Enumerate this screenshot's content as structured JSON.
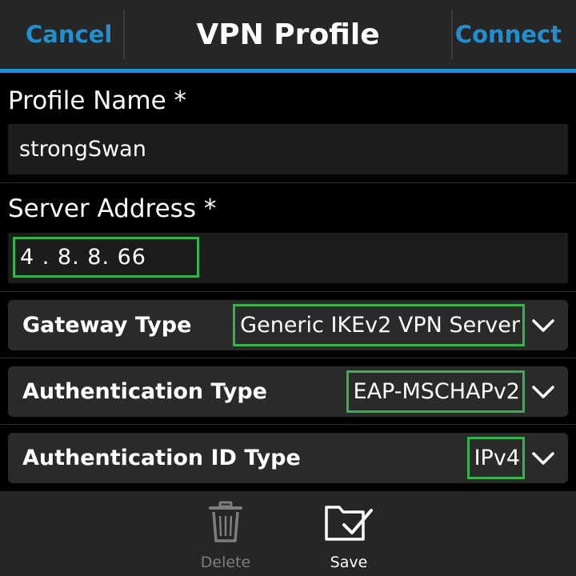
{
  "header": {
    "cancel_label": "Cancel",
    "title": "VPN Profile",
    "connect_label": "Connect"
  },
  "profile_name": {
    "label": "Profile Name *",
    "value": "strongSwan"
  },
  "server_address": {
    "label": "Server Address *",
    "value": "4 . 8. 8. 66"
  },
  "gateway_type": {
    "label": "Gateway Type",
    "value": "Generic IKEv2 VPN Server"
  },
  "authentication_type": {
    "label": "Authentication Type",
    "value": "EAP-MSCHAPv2"
  },
  "authentication_id_type": {
    "label": "Authentication ID Type",
    "value": "IPv4"
  },
  "actions": {
    "delete_label": "Delete",
    "save_label": "Save"
  },
  "colors": {
    "accent": "#1f8fd0",
    "highlight": "#35b24a",
    "background": "#000000",
    "bar": "#262626"
  }
}
